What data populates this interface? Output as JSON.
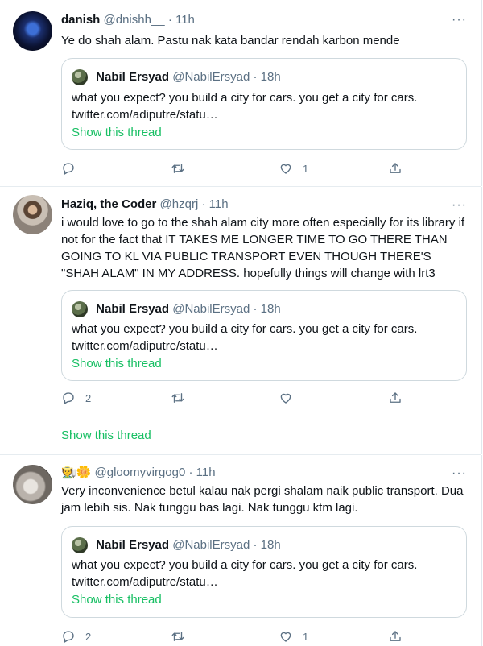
{
  "colors": {
    "accent_green": "#17bf63",
    "secondary_text": "#5b7083",
    "border": "#cfd9de"
  },
  "tweets": [
    {
      "name": "danish",
      "handle": "@dnishh__",
      "dot": "·",
      "time": "11h",
      "more": "···",
      "text": "Ye do shah alam. Pastu nak kata bandar rendah karbon mende",
      "quote": {
        "name": "Nabil Ersyad",
        "handle": "@NabilErsyad",
        "dot": "·",
        "time": "18h",
        "line1": "what you expect? you build a city for cars. you get a city for cars.",
        "line2": "twitter.com/adiputre/statu…",
        "show_thread": "Show this thread"
      },
      "reply_count": "",
      "retweet_count": "",
      "like_count": "1"
    },
    {
      "name": "Haziq, the Coder",
      "handle": "@hzqrj",
      "dot": "·",
      "time": "11h",
      "more": "···",
      "text": "i would love to go to the shah alam city more often especially for its library if not for the fact that IT TAKES ME LONGER TIME TO GO THERE THAN GOING TO KL VIA PUBLIC TRANSPORT EVEN THOUGH THERE'S \"SHAH ALAM\" IN MY ADDRESS. hopefully things will change with lrt3",
      "quote": {
        "name": "Nabil Ersyad",
        "handle": "@NabilErsyad",
        "dot": "·",
        "time": "18h",
        "line1": "what you expect? you build a city for cars. you get a city for cars.",
        "line2": "twitter.com/adiputre/statu…",
        "show_thread": "Show this thread"
      },
      "reply_count": "2",
      "retweet_count": "",
      "like_count": "",
      "show_thread": "Show this thread"
    },
    {
      "name": "🧑‍🌾🌼",
      "handle": "@gloomyvirgog0",
      "dot": "·",
      "time": "11h",
      "more": "···",
      "text": "Very inconvenience betul kalau nak pergi shalam naik public transport. Dua jam lebih sis. Nak tunggu bas lagi. Nak tunggu ktm lagi.",
      "quote": {
        "name": "Nabil Ersyad",
        "handle": "@NabilErsyad",
        "dot": "·",
        "time": "18h",
        "line1": "what you expect? you build a city for cars. you get a city for cars.",
        "line2": "twitter.com/adiputre/statu…",
        "show_thread": "Show this thread"
      },
      "reply_count": "2",
      "retweet_count": "",
      "like_count": "1"
    }
  ]
}
